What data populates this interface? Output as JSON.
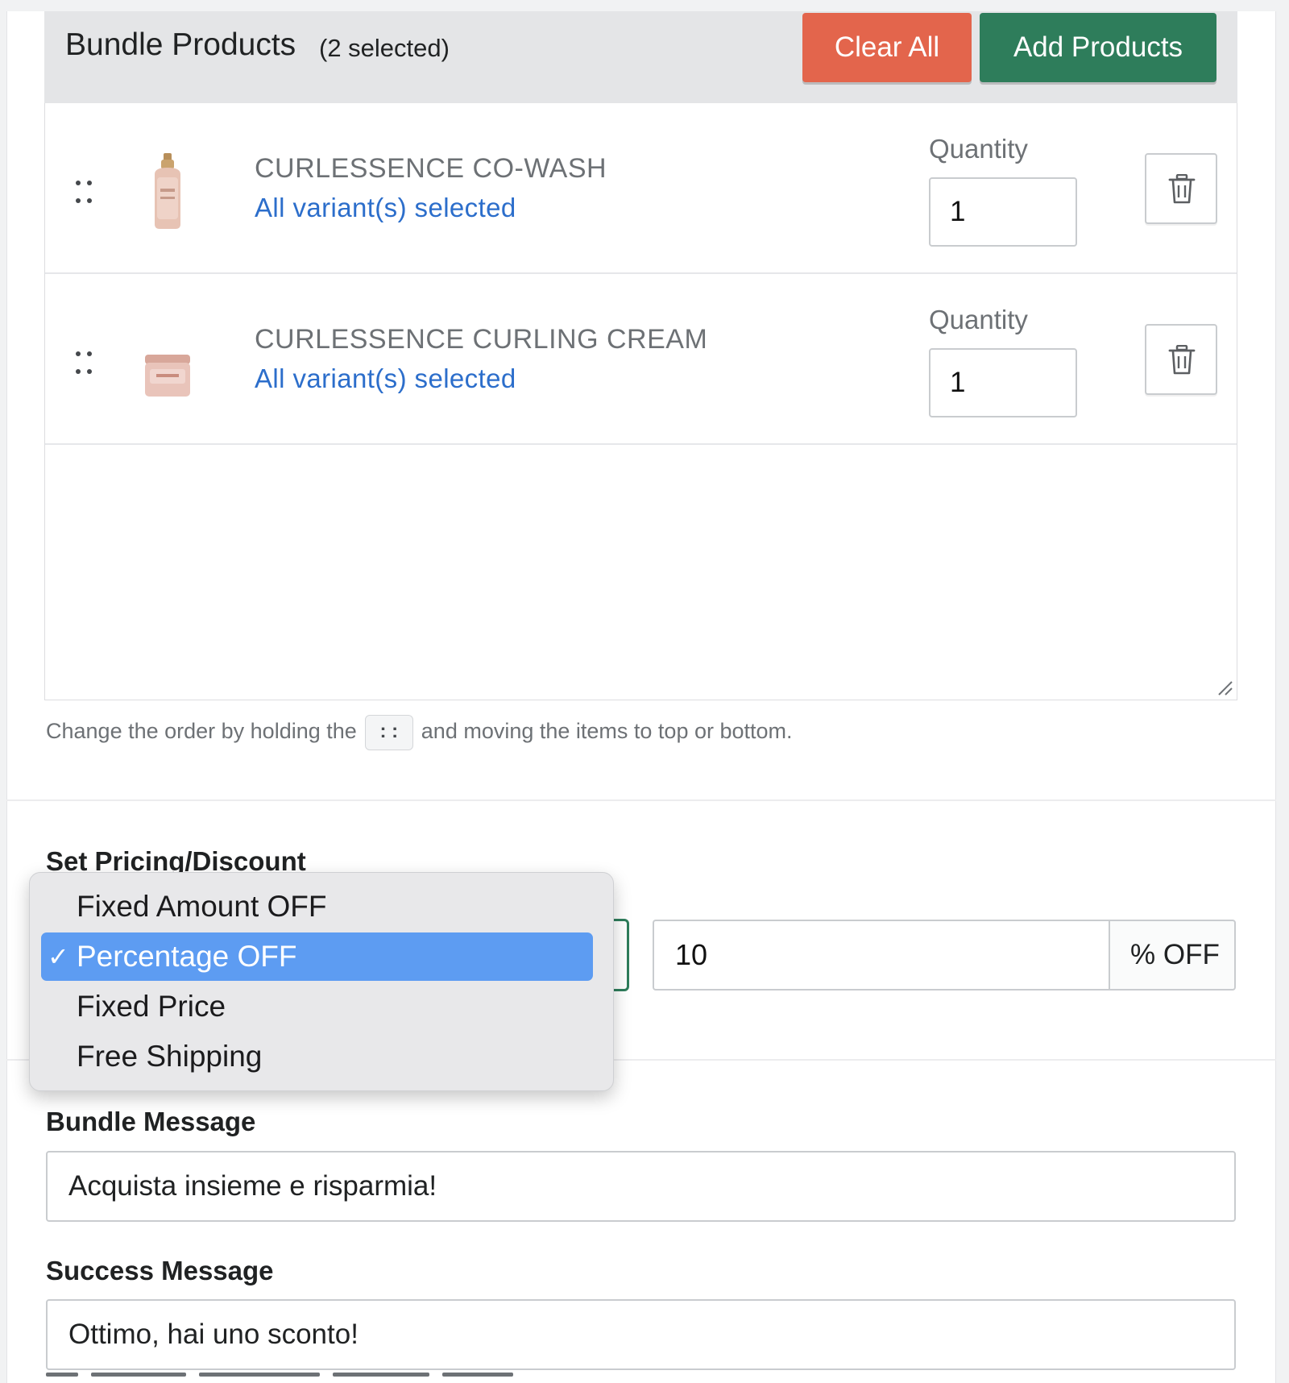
{
  "bundle": {
    "title": "Bundle Products",
    "selected_count": "(2 selected)",
    "clear_all_label": "Clear All",
    "add_products_label": "Add Products",
    "products": [
      {
        "name": "CURLESSENCE CO-WASH",
        "variants": "All variant(s) selected",
        "quantity_label": "Quantity",
        "quantity": "1"
      },
      {
        "name": "CURLESSENCE CURLING CREAM",
        "variants": "All variant(s) selected",
        "quantity_label": "Quantity",
        "quantity": "1"
      }
    ],
    "help_text_before": "Change the order by holding the",
    "help_text_key": ": :",
    "help_text_after": "and moving the items to top or bottom."
  },
  "pricing": {
    "label": "Set Pricing/Discount",
    "options": [
      "Fixed Amount OFF",
      "Percentage OFF",
      "Fixed Price",
      "Free Shipping"
    ],
    "selected_option": "Percentage OFF",
    "check_mark": "✓",
    "discount_value": "10",
    "discount_suffix": "% OFF"
  },
  "bundle_message": {
    "label": "Bundle Message",
    "value": "Acquista insieme e risparmia!"
  },
  "success_message": {
    "label": "Success Message",
    "value": "Ottimo, hai uno sconto!"
  },
  "icons": {
    "drag": "drag-handle-icon",
    "delete": "trash-icon",
    "resize": "resize-grip-icon"
  },
  "colors": {
    "clear_button": "#e3654c",
    "add_button": "#2e7d5b",
    "link": "#2c6ecb",
    "selected_option": "#5d9cf2",
    "select_focus_border": "#2e7d5b"
  }
}
